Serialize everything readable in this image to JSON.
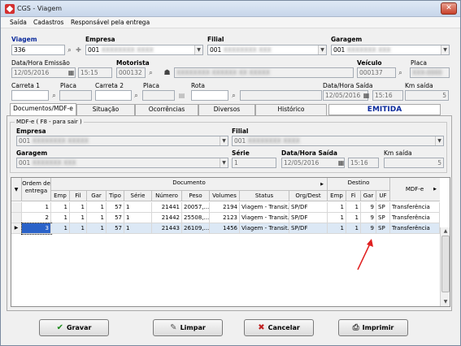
{
  "window": {
    "title": "CGS - Viagem",
    "close": "✕"
  },
  "menu": [
    "Saída",
    "Cadastros",
    "Responsável pela entrega"
  ],
  "viagem": {
    "label": "Viagem",
    "value": "336"
  },
  "empresa": {
    "label": "Empresa",
    "value": "001"
  },
  "filial": {
    "label": "Filial",
    "value": "001"
  },
  "garagem": {
    "label": "Garagem",
    "value": "001"
  },
  "data_emissao": {
    "label": "Data/Hora Emissão",
    "date": "12/05/2016",
    "time": "15:15"
  },
  "motorista": {
    "label": "Motorista",
    "value": "000132"
  },
  "veiculo": {
    "label": "Veículo",
    "value": "000137"
  },
  "placa_top": {
    "label": "Placa"
  },
  "carreta1": {
    "label": "Carreta 1"
  },
  "placa1": {
    "label": "Placa"
  },
  "carreta2": {
    "label": "Carreta 2"
  },
  "placa2": {
    "label": "Placa"
  },
  "rota": {
    "label": "Rota"
  },
  "data_saida": {
    "label": "Data/Hora Saída",
    "date": "12/05/2016",
    "time": "15:16"
  },
  "km_saida": {
    "label": "Km saída",
    "value": "5"
  },
  "tabs": [
    "Documentos/MDF-e",
    "Situação",
    "Ocorrências",
    "Diversos",
    "Histórico"
  ],
  "status": "EMITIDA",
  "mdfe": {
    "title": "MDF-e ( F8 - para sair )",
    "empresa": {
      "label": "Empresa",
      "value": "001"
    },
    "filial": {
      "label": "Filial",
      "value": "001"
    },
    "garagem": {
      "label": "Garagem",
      "value": "001"
    },
    "serie": {
      "label": "Série",
      "value": "1"
    },
    "data": {
      "label": "Data/Hora Saída",
      "date": "12/05/2016",
      "time": "15:16"
    },
    "km": {
      "label": "Km saída",
      "value": "5"
    }
  },
  "grid": {
    "group_headers": {
      "documento": "Documento",
      "destino": "Destino",
      "mdfe": "MDF-e"
    },
    "columns": {
      "ordem": "Ordem de entrega",
      "emp": "Emp",
      "fil": "Fil",
      "gar": "Gar",
      "tipo": "Tipo",
      "serie": "Série",
      "numero": "Número",
      "peso": "Peso",
      "volumes": "Volumes",
      "status": "Status",
      "orgdest": "Org/Dest",
      "demp": "Emp",
      "dfi": "Fi",
      "dgar": "Gar",
      "uf": "UF"
    },
    "rows": [
      {
        "ordem": "1",
        "emp": "1",
        "fil": "1",
        "gar": "1",
        "tipo": "57",
        "serie": "1",
        "numero": "21441",
        "peso": "20057,...",
        "volumes": "2194",
        "status": "Viagem - Transit...",
        "orgdest": "SP/DF",
        "demp": "1",
        "dfi": "1",
        "dgar": "9",
        "uf": "SP",
        "mdfe": "Transferência"
      },
      {
        "ordem": "2",
        "emp": "1",
        "fil": "1",
        "gar": "1",
        "tipo": "57",
        "serie": "1",
        "numero": "21442",
        "peso": "25508,...",
        "volumes": "2123",
        "status": "Viagem - Transit...",
        "orgdest": "SP/DF",
        "demp": "1",
        "dfi": "1",
        "dgar": "9",
        "uf": "SP",
        "mdfe": "Transferência"
      },
      {
        "ordem": "3",
        "emp": "1",
        "fil": "1",
        "gar": "1",
        "tipo": "57",
        "serie": "1",
        "numero": "21443",
        "peso": "26109,...",
        "volumes": "1456",
        "status": "Viagem - Transit...",
        "orgdest": "SP/DF",
        "demp": "1",
        "dfi": "1",
        "dgar": "9",
        "uf": "SP",
        "mdfe": "Transferência"
      }
    ]
  },
  "buttons": {
    "gravar": "Gravar",
    "limpar": "Limpar",
    "cancelar": "Cancelar",
    "imprimir": "Imprimir"
  },
  "colors": {
    "accent": "#0a2a9c",
    "annotation": "#e02020",
    "selected_row": "#dce8f5"
  }
}
